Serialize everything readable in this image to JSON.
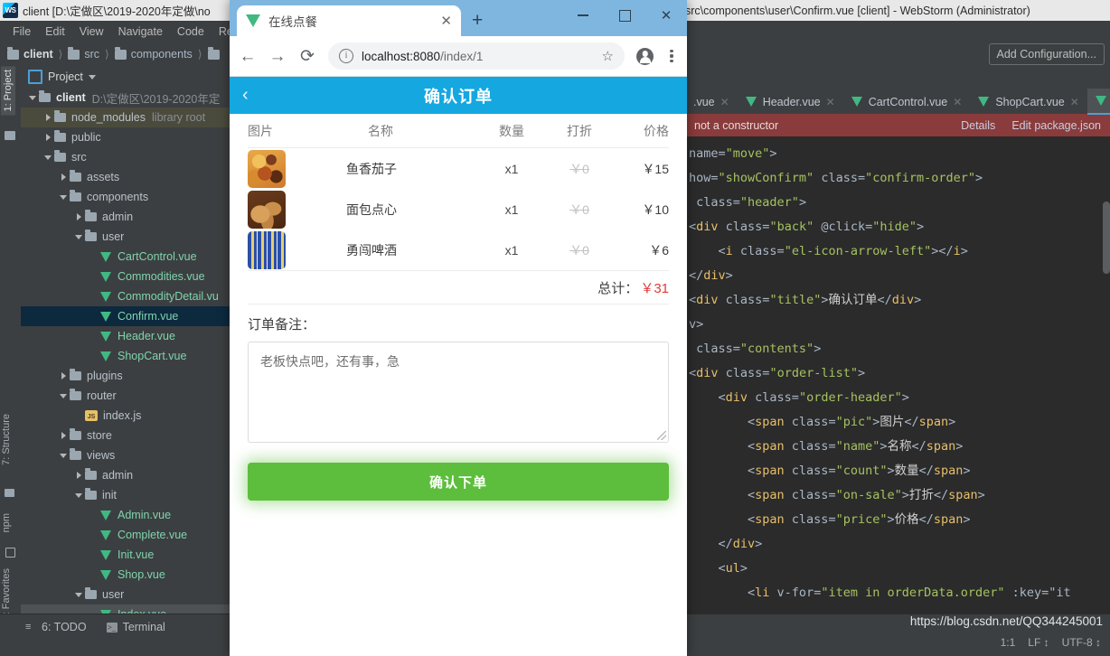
{
  "ide": {
    "title": "client [D:\\定做区\\2019-2020年定做\\no",
    "title_right": "src\\components\\user\\Confirm.vue [client] - WebStorm (Administrator)",
    "logo_text": "WS",
    "menu": [
      "File",
      "Edit",
      "View",
      "Navigate",
      "Code",
      "Refa"
    ],
    "breadcrumb": [
      "client",
      "src",
      "components"
    ],
    "run_config": "Add Configuration...",
    "tool_tabs_left": [
      "1: Project",
      "7: Structure",
      "npm",
      "2: Favorites"
    ],
    "tree_header": "Project",
    "tree": [
      {
        "label": "client",
        "suffix": "D:\\定做区\\2019-2020年定",
        "indent": 0,
        "type": "folder",
        "twisty": "down",
        "strong": true,
        "state": "none"
      },
      {
        "label": "node_modules",
        "suffix": "library root",
        "indent": 1,
        "type": "folder",
        "twisty": "right",
        "strong": false,
        "state": "hl"
      },
      {
        "label": "public",
        "suffix": "",
        "indent": 1,
        "type": "folder",
        "twisty": "right",
        "strong": false,
        "state": "none"
      },
      {
        "label": "src",
        "suffix": "",
        "indent": 1,
        "type": "folder",
        "twisty": "down",
        "strong": false,
        "state": "none"
      },
      {
        "label": "assets",
        "suffix": "",
        "indent": 2,
        "type": "folder",
        "twisty": "right",
        "strong": false,
        "state": "none"
      },
      {
        "label": "components",
        "suffix": "",
        "indent": 2,
        "type": "folder",
        "twisty": "down",
        "strong": false,
        "state": "none"
      },
      {
        "label": "admin",
        "suffix": "",
        "indent": 3,
        "type": "folder",
        "twisty": "right",
        "strong": false,
        "state": "none"
      },
      {
        "label": "user",
        "suffix": "",
        "indent": 3,
        "type": "folder",
        "twisty": "down",
        "strong": false,
        "state": "none"
      },
      {
        "label": "CartControl.vue",
        "suffix": "",
        "indent": 4,
        "type": "vue",
        "twisty": "none",
        "strong": false,
        "state": "none"
      },
      {
        "label": "Commodities.vue",
        "suffix": "",
        "indent": 4,
        "type": "vue",
        "twisty": "none",
        "strong": false,
        "state": "none"
      },
      {
        "label": "CommodityDetail.vu",
        "suffix": "",
        "indent": 4,
        "type": "vue",
        "twisty": "none",
        "strong": false,
        "state": "none"
      },
      {
        "label": "Confirm.vue",
        "suffix": "",
        "indent": 4,
        "type": "vue",
        "twisty": "none",
        "strong": false,
        "state": "sel"
      },
      {
        "label": "Header.vue",
        "suffix": "",
        "indent": 4,
        "type": "vue",
        "twisty": "none",
        "strong": false,
        "state": "none"
      },
      {
        "label": "ShopCart.vue",
        "suffix": "",
        "indent": 4,
        "type": "vue",
        "twisty": "none",
        "strong": false,
        "state": "none"
      },
      {
        "label": "plugins",
        "suffix": "",
        "indent": 2,
        "type": "folder",
        "twisty": "right",
        "strong": false,
        "state": "none"
      },
      {
        "label": "router",
        "suffix": "",
        "indent": 2,
        "type": "folder",
        "twisty": "down",
        "strong": false,
        "state": "none"
      },
      {
        "label": "index.js",
        "suffix": "",
        "indent": 3,
        "type": "js",
        "twisty": "none",
        "strong": false,
        "state": "none"
      },
      {
        "label": "store",
        "suffix": "",
        "indent": 2,
        "type": "folder",
        "twisty": "right",
        "strong": false,
        "state": "none"
      },
      {
        "label": "views",
        "suffix": "",
        "indent": 2,
        "type": "folder",
        "twisty": "down",
        "strong": false,
        "state": "none"
      },
      {
        "label": "admin",
        "suffix": "",
        "indent": 3,
        "type": "folder",
        "twisty": "right",
        "strong": false,
        "state": "none"
      },
      {
        "label": "init",
        "suffix": "",
        "indent": 3,
        "type": "folder",
        "twisty": "down",
        "strong": false,
        "state": "none"
      },
      {
        "label": "Admin.vue",
        "suffix": "",
        "indent": 4,
        "type": "vue",
        "twisty": "none",
        "strong": false,
        "state": "none"
      },
      {
        "label": "Complete.vue",
        "suffix": "",
        "indent": 4,
        "type": "vue",
        "twisty": "none",
        "strong": false,
        "state": "none"
      },
      {
        "label": "Init.vue",
        "suffix": "",
        "indent": 4,
        "type": "vue",
        "twisty": "none",
        "strong": false,
        "state": "none"
      },
      {
        "label": "Shop.vue",
        "suffix": "",
        "indent": 4,
        "type": "vue",
        "twisty": "none",
        "strong": false,
        "state": "none"
      },
      {
        "label": "user",
        "suffix": "",
        "indent": 3,
        "type": "folder",
        "twisty": "down",
        "strong": false,
        "state": "none"
      },
      {
        "label": "Index.vue",
        "suffix": "",
        "indent": 4,
        "type": "vue",
        "twisty": "none",
        "strong": false,
        "state": "bottomsel"
      }
    ],
    "editor_tabs": [
      {
        "label": ".vue",
        "active": false,
        "icon": false
      },
      {
        "label": "Header.vue",
        "active": false,
        "icon": true
      },
      {
        "label": "CartControl.vue",
        "active": false,
        "icon": true
      },
      {
        "label": "ShopCart.vue",
        "active": false,
        "icon": true
      },
      {
        "label": "",
        "active": true,
        "icon": true
      }
    ],
    "error_bar": {
      "message": "not a constructor",
      "details": "Details",
      "edit": "Edit package.json"
    },
    "code_lines": [
      "name=\"move\">",
      "how=\"showConfirm\" class=\"confirm-order\">",
      " class=\"header\">",
      "<div class=\"back\" @click=\"hide\">",
      "    <i class=\"el-icon-arrow-left\"></i>",
      "</div>",
      "<div class=\"title\">确认订单</div>",
      "v>",
      " class=\"contents\">",
      "<div class=\"order-list\">",
      "    <div class=\"order-header\">",
      "        <span class=\"pic\">图片</span>",
      "        <span class=\"name\">名称</span>",
      "        <span class=\"count\">数量</span>",
      "        <span class=\"on-sale\">打折</span>",
      "        <span class=\"price\">价格</span>",
      "    </div>",
      "    <ul>",
      "        <li v-for=\"item in orderData.order\" :key=\"it"
    ],
    "bottom_tools": [
      {
        "label": "6: TODO"
      },
      {
        "label": "Terminal"
      }
    ],
    "watermark": "https://blog.csdn.net/QQ344245001",
    "status": [
      "1:1",
      "LF",
      "UTF-8"
    ]
  },
  "browser": {
    "tab_title": "在线点餐",
    "new_tab": "+",
    "close_tab": "✕",
    "window_buttons": [
      "minimize",
      "maximize",
      "close"
    ],
    "back": "←",
    "forward": "→",
    "reload": "⟳",
    "url_host": "localhost:8080",
    "url_path": "/index/1",
    "url_full": "localhost:8080/index/1"
  },
  "app": {
    "header_title": "确认订单",
    "back_icon": "‹",
    "accent_blue": "#14a7e0",
    "accent_green": "#5cbe3c",
    "total_red": "#e03b3b",
    "table_headers": {
      "pic": "图片",
      "name": "名称",
      "count": "数量",
      "sale": "打折",
      "price": "价格"
    },
    "items": [
      {
        "name": "鱼香茄子",
        "count": "x1",
        "sale": "￥0",
        "price": "￥15",
        "thumb": "eggplant-dish"
      },
      {
        "name": "面包点心",
        "count": "x1",
        "sale": "￥0",
        "price": "￥10",
        "thumb": "bread-pastry"
      },
      {
        "name": "勇闯啤酒",
        "count": "x1",
        "sale": "￥0",
        "price": "￥6",
        "thumb": "beer-bottles"
      }
    ],
    "total_label": "总计：",
    "total_value": "￥31",
    "remark_label": "订单备注：",
    "remark_value": "老板快点吧，还有事，急",
    "submit_label": "确认下单"
  }
}
